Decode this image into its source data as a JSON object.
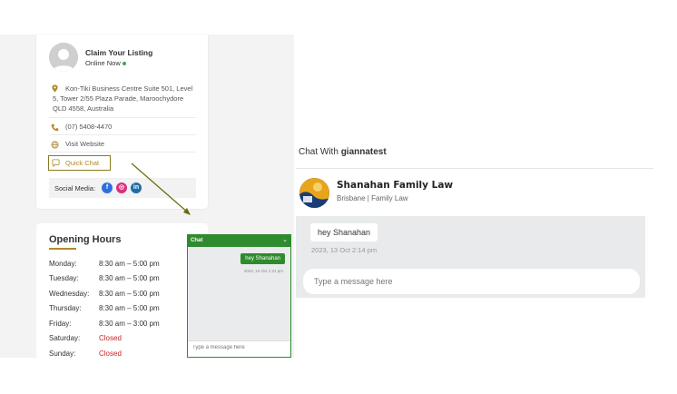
{
  "listing": {
    "title": "Claim Your Listing",
    "status": "Online Now",
    "address": "Kon-Tiki Business Centre Suite 501, Level 5, Tower 2/55 Plaza Parade, Maroochydore QLD 4558, Australia",
    "phone": "(07) 5408-4470",
    "website_label": "Visit Website",
    "quick_chat_label": "Quick Chat",
    "social_label": "Social Media:",
    "social": [
      {
        "name": "facebook",
        "glyph": "f",
        "color": "#2e6fe0"
      },
      {
        "name": "instagram",
        "glyph": "◎",
        "color": "#d9307e"
      },
      {
        "name": "linkedin",
        "glyph": "in",
        "color": "#1e6fa8"
      }
    ],
    "accent_color": "#b0892a"
  },
  "hours": {
    "title": "Opening Hours",
    "rows": [
      {
        "day": "Monday:",
        "time": "8:30 am – 5:00 pm",
        "closed": false
      },
      {
        "day": "Tuesday:",
        "time": "8:30 am – 5:00 pm",
        "closed": false
      },
      {
        "day": "Wednesday:",
        "time": "8:30 am – 5:00 pm",
        "closed": false
      },
      {
        "day": "Thursday:",
        "time": "8:30 am – 5:00 pm",
        "closed": false
      },
      {
        "day": "Friday:",
        "time": "8:30 am – 3:00 pm",
        "closed": false
      },
      {
        "day": "Saturday:",
        "time": "Closed",
        "closed": true
      },
      {
        "day": "Sunday:",
        "time": "Closed",
        "closed": true
      }
    ]
  },
  "chat_widget": {
    "title": "Chat",
    "toggle": "⌄",
    "message": "hey Shanahan",
    "time": "2023, 13 Oct 1:21 pm",
    "placeholder": "Type a message here",
    "color": "#2e8b2e"
  },
  "chat_panel": {
    "heading_prefix": "Chat With",
    "username": "giannatest",
    "firm_name": "Shanahan Family Law",
    "firm_sub": "Brisbane | Family Law",
    "message": "hey Shanahan",
    "time": "2023, 13 Oct 2:14 pm",
    "placeholder": "Type a message here"
  }
}
